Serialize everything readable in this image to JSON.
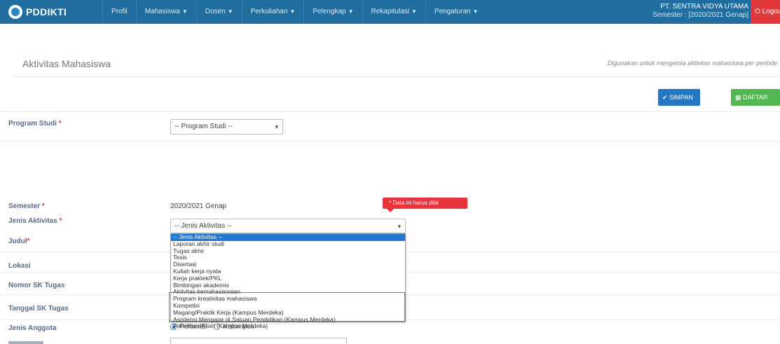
{
  "navbar": {
    "brand": "PDDIKTI",
    "menu": [
      {
        "label": "Profil",
        "has_caret": false
      },
      {
        "label": "Mahasiswa",
        "has_caret": true
      },
      {
        "label": "Dosen",
        "has_caret": true
      },
      {
        "label": "Perkuliahan",
        "has_caret": true
      },
      {
        "label": "Pelengkap",
        "has_caret": true
      },
      {
        "label": "Rekapitulasi",
        "has_caret": true
      },
      {
        "label": "Pengaturan",
        "has_caret": true
      }
    ],
    "institution": "PT. SENTRA VIDYA UTAMA",
    "semester": "Semester : [2020/2021 Genap]",
    "logout": "Logout",
    "colors": {
      "bar": "#1f6e9f",
      "logout": "#e2383b"
    }
  },
  "header": {
    "title": "Aktivitas Mahasiswa",
    "description": "Digunakan untuk mengelola aktivitas mahasiswa per periode"
  },
  "toolbar": {
    "save_label": "SIMPAN",
    "list_label": "DAFTAR"
  },
  "form": {
    "program_studi": {
      "label": "Program Studi",
      "value": "-- Program Studi --"
    },
    "semester": {
      "label": "Semester",
      "value": "2020/2021 Genap"
    },
    "jenis_aktivitas": {
      "label": "Jenis Aktivitas",
      "value": "-- Jenis Aktivitas --"
    },
    "judul": {
      "label": "Judul"
    },
    "lokasi": {
      "label": "Lokasi"
    },
    "nomor_sk": {
      "label": "Nomor SK Tugas"
    },
    "tanggal_sk": {
      "label": "Tanggal SK Tugas"
    },
    "jenis_anggota": {
      "label": "Jenis Anggota",
      "options": [
        "Personal",
        "Kelompok"
      ],
      "selected": "Personal"
    },
    "required_marker": "*",
    "tooltip": "* Data ini harus diisi"
  },
  "dropdown": {
    "options": [
      "-- Jenis Aktivitas --",
      "Laporan akhir studi",
      "Tugas akhir",
      "Tesis",
      "Disertasi",
      "Kuliah kerja nyata",
      "Kerja praktek/PKL",
      "Bimbingan akademis",
      "Aktivitas kemahasiswaan",
      "Program kreativitas mahasiswa",
      "Kompetisi",
      "Magang/Praktik Kerja (Kampus Merdeka)",
      "Asistensi Mengajar di Satuan Pendidikan (Kampus Merdeka)",
      "Penelitian/Riset (Kampus Merdeka)"
    ],
    "selected_index": 0
  }
}
